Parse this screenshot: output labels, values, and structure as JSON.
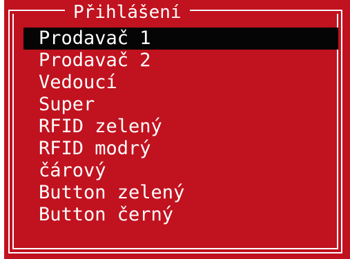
{
  "dialog": {
    "title": "Přihlášení",
    "selected_index": 0,
    "items": [
      {
        "label": "Prodavač 1"
      },
      {
        "label": "Prodavač 2"
      },
      {
        "label": "Vedoucí"
      },
      {
        "label": "Super"
      },
      {
        "label": "RFID zelený"
      },
      {
        "label": "RFID modrý"
      },
      {
        "label": "čárový"
      },
      {
        "label": "Button zelený"
      },
      {
        "label": "Button černý"
      }
    ]
  },
  "colors": {
    "background": "#c1121f",
    "text": "#ffffff",
    "selection": "#050505"
  }
}
